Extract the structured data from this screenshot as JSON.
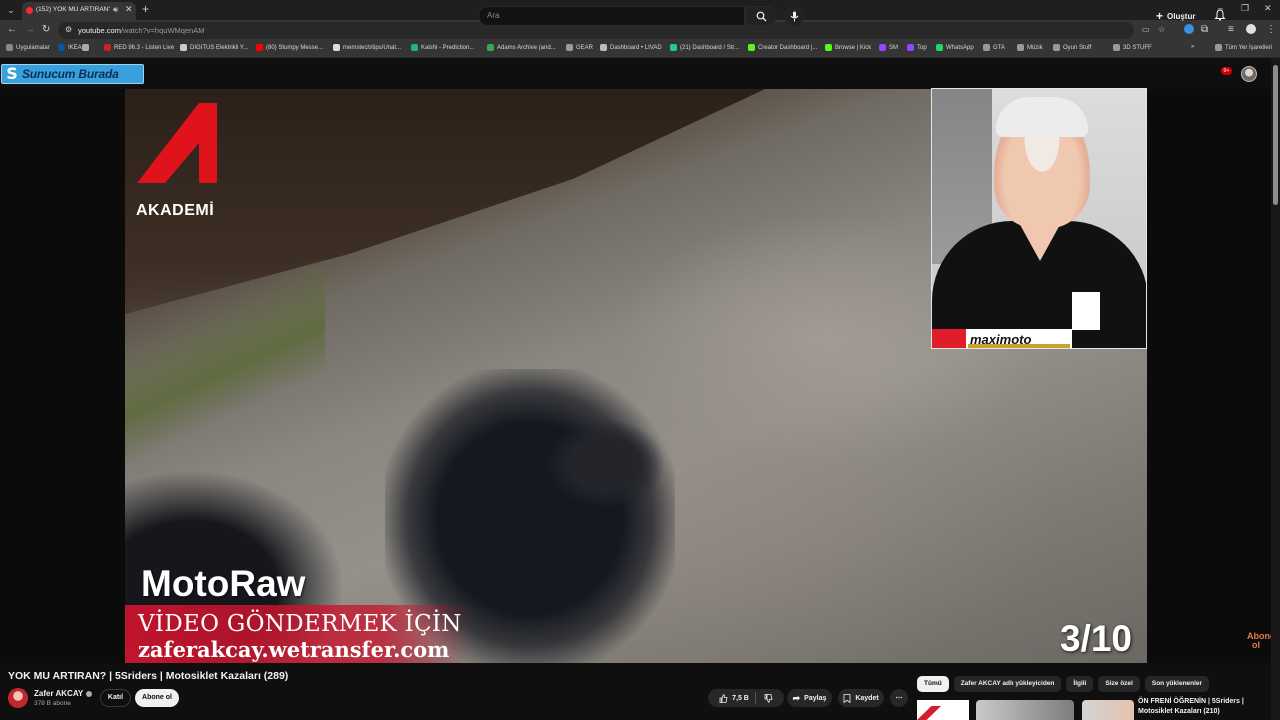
{
  "browser": {
    "tab_title": "(152) YOK MU ARTIRAN? | ...",
    "url_host": "youtube.com",
    "url_path": "/watch?v=hquWMqenAM",
    "bookmarks": [
      {
        "label": "Uygulamalar",
        "color": "#888888"
      },
      {
        "label": "IKEA",
        "color": "#0058a3"
      },
      {
        "label": "",
        "color": "#aaaaaa"
      },
      {
        "label": "RED 96.3 - Listen Live",
        "color": "#cc2222"
      },
      {
        "label": "DIGITUS Elektrikli Y...",
        "color": "#cccccc"
      },
      {
        "label": "(80) Stumpy Messe...",
        "color": "#ff0000"
      },
      {
        "label": "memstech/tips/Unat...",
        "color": "#dddddd"
      },
      {
        "label": "Kalshi - Prediction...",
        "color": "#1db584"
      },
      {
        "label": "Adams Archive (and...",
        "color": "#34a853"
      },
      {
        "label": "GEAR",
        "color": "#999999"
      },
      {
        "label": "Dashboard • LIVAD",
        "color": "#bbbbbb"
      },
      {
        "label": "(21) Dashboard / Str...",
        "color": "#20c997"
      },
      {
        "label": "Creator Dashboard |...",
        "color": "#53fc18"
      },
      {
        "label": "Browse | Kick",
        "color": "#53fc18"
      },
      {
        "label": "SM",
        "color": "#9146ff"
      },
      {
        "label": "Top",
        "color": "#9146ff"
      },
      {
        "label": "WhatsApp",
        "color": "#25d366"
      },
      {
        "label": "GTA",
        "color": "#999999"
      },
      {
        "label": "Müzik",
        "color": "#999999"
      },
      {
        "label": "Oyun Stuff",
        "color": "#999999"
      },
      {
        "label": "3D STUFF",
        "color": "#999999"
      }
    ],
    "all_bookmarks": "Tüm Yer İşaretleri"
  },
  "header": {
    "logo_text": "Sunucum Burada",
    "search_placeholder": "Ara",
    "create_label": "Oluştur",
    "notif_count": "9+"
  },
  "video": {
    "brand_label": "AKADEMİ",
    "pip_brand": "maximoto",
    "overlay_title": "MotoRaw",
    "overlay_send": "VİDEO GÖNDERMEK İÇİN",
    "overlay_link": "zaferakcay.wetransfer.com",
    "counter": "3/10",
    "watermark": "Abone ol"
  },
  "info": {
    "title": "YOK MU ARTIRAN? | 5Sriders | Motosiklet Kazaları (289)",
    "channel": "Zafer AKCAY",
    "subscribers": "378 B abone",
    "join_label": "Katıl",
    "subscribe_label": "Abone ol",
    "likes": "7,5 B",
    "share_label": "Paylaş",
    "save_label": "Kaydet"
  },
  "sidebar": {
    "chips": [
      "Tümü",
      "Zafer AKCAY adlı yükleyiciden",
      "İlgili",
      "Size özel",
      "Son yüklenenler"
    ],
    "rec_title": "ÖN FRENİ ÖĞRENİN | 5Sriders | Motosiklet Kazaları (210)"
  },
  "colors": {
    "accent_red": "#cc1430",
    "youtube_bg": "#0f0f0f",
    "logo_blue": "#38a0dc"
  }
}
